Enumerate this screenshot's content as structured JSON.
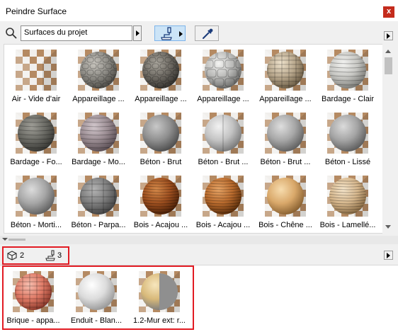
{
  "window": {
    "title": "Peindre Surface",
    "close_label": "x"
  },
  "toolbar": {
    "search_value": "Surfaces du projet",
    "search_icon": "search-icon",
    "paint_icon": "paint-roller-icon",
    "picker_icon": "eyedropper-icon",
    "accent": "#cce4f7"
  },
  "materials": [
    {
      "label": "Air - Vide d'air",
      "kind": "empty"
    },
    {
      "label": "Appareillage ...",
      "base": "#8e8c86",
      "light": "#c9c6bf",
      "dark": "#4e4c47",
      "pattern": "stone"
    },
    {
      "label": "Appareillage ...",
      "base": "#6f6b64",
      "light": "#a9a59c",
      "dark": "#35332f",
      "pattern": "cobble"
    },
    {
      "label": "Appareillage ...",
      "base": "#b9b9b7",
      "light": "#f4f4f2",
      "dark": "#6e6e6c",
      "pattern": "flag"
    },
    {
      "label": "Appareillage ...",
      "base": "#b8a78c",
      "light": "#eee2cc",
      "dark": "#6b5c45",
      "pattern": "bricks"
    },
    {
      "label": "Bardage - Clair",
      "base": "#c7c7c3",
      "light": "#f3f3f1",
      "dark": "#7b7b77",
      "pattern": "planks"
    },
    {
      "label": "Bardage - Fo...",
      "base": "#6a6a64",
      "light": "#a09f98",
      "dark": "#383834",
      "pattern": "planks"
    },
    {
      "label": "Bardage - Mo...",
      "base": "#9a8c92",
      "light": "#d3c8cd",
      "dark": "#5b4f55",
      "pattern": "planks"
    },
    {
      "label": "Béton - Brut",
      "base": "#8f8f8f",
      "light": "#c8c8c8",
      "dark": "#4f4f4f",
      "pattern": "plain"
    },
    {
      "label": "Béton - Brut ...",
      "base": "#c3c3c3",
      "light": "#f2f2f2",
      "dark": "#7a7a7a",
      "pattern": "seam"
    },
    {
      "label": "Béton - Brut ...",
      "base": "#a7a7a7",
      "light": "#dedede",
      "dark": "#616161",
      "pattern": "plain"
    },
    {
      "label": "Béton - Lissé",
      "base": "#a4a4a4",
      "light": "#dbdbdb",
      "dark": "#5e5e5e",
      "pattern": "plain"
    },
    {
      "label": "Béton - Morti...",
      "base": "#a6a6a6",
      "light": "#dcdcdc",
      "dark": "#626262",
      "pattern": "plain"
    },
    {
      "label": "Béton - Parpa...",
      "base": "#7d7d7d",
      "light": "#b4b4b4",
      "dark": "#444444",
      "pattern": "blocks"
    },
    {
      "label": "Bois - Acajou ...",
      "base": "#9d4f1f",
      "light": "#d68a4a",
      "dark": "#4e2208",
      "pattern": "wood"
    },
    {
      "label": "Bois - Acajou ...",
      "base": "#b86a2d",
      "light": "#e8a566",
      "dark": "#5e300c",
      "pattern": "wood"
    },
    {
      "label": "Bois - Chêne ...",
      "base": "#d9a86a",
      "light": "#f7dcae",
      "dark": "#8a6232",
      "pattern": "plain"
    },
    {
      "label": "Bois - Lamellé...",
      "base": "#d6b78d",
      "light": "#f6e6cb",
      "dark": "#8a6c45",
      "pattern": "wood"
    }
  ],
  "counts": {
    "objects": "2",
    "surfaces": "3"
  },
  "used_materials": [
    {
      "label": "Brique - appa...",
      "base": "#e07a66",
      "light": "#f7c0b1",
      "dark": "#8e3b2d",
      "pattern": "bricks"
    },
    {
      "label": "Enduit - Blan...",
      "base": "#dcdcdc",
      "light": "#ffffff",
      "dark": "#9a9a9a",
      "pattern": "plain"
    },
    {
      "label": "1.2-Mur ext: r...",
      "base": "#d8b97a",
      "light": "#f7e6bd",
      "dark": "#7c7c7c",
      "pattern": "split"
    }
  ]
}
